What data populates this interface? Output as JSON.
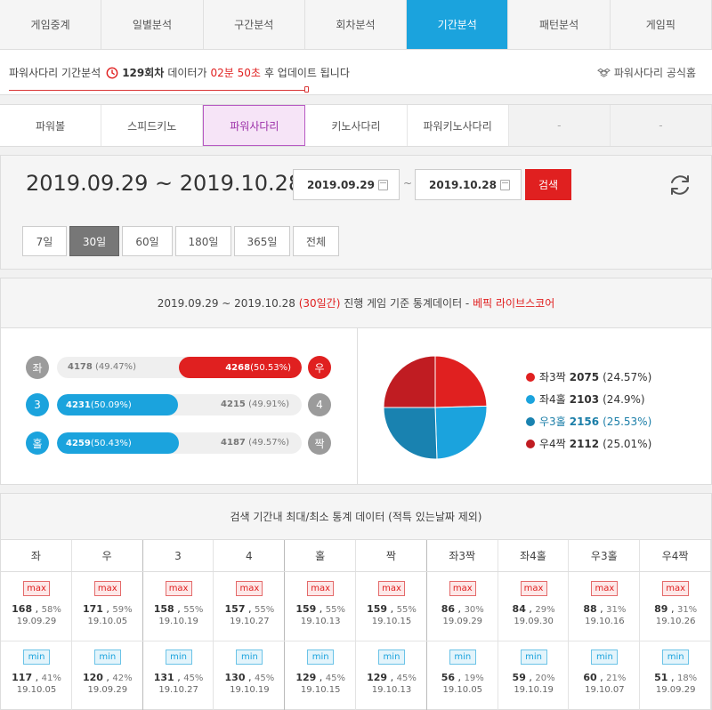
{
  "top_nav": [
    "게임중계",
    "일별분석",
    "구간분석",
    "회차분석",
    "기간분석",
    "패턴분석",
    "게임픽"
  ],
  "top_nav_active": 4,
  "info_bar": {
    "prefix": "파워사다리 기간분석",
    "round": "129회차",
    "mid": "데이터가",
    "timer": "02분 50초",
    "suffix": "후 업데이트 됩니다",
    "official": "파워사다리 공식홈"
  },
  "sub_nav": [
    "파워볼",
    "스피드키노",
    "파워사다리",
    "키노사다리",
    "파워키노사다리",
    "-",
    "-"
  ],
  "sub_nav_active": 2,
  "period": {
    "range": "2019.09.29 ~ 2019.10.28",
    "start": "2019.09.29",
    "tilde": "~",
    "end": "2019.10.28",
    "search_label": "검색",
    "buttons": [
      "7일",
      "30일",
      "60일",
      "180일",
      "365일",
      "전체"
    ],
    "active_button": 1
  },
  "stats": {
    "head_range": "2019.09.29 ~ 2019.10.28",
    "head_days": "(30일간)",
    "head_mid": "진행 게임 기준 통계데이터 -",
    "head_brand": "베픽 라이브스코어",
    "rows": [
      {
        "left_label": "좌",
        "left_count": "4178",
        "left_pct": "(49.47%)",
        "right_label": "우",
        "right_count": "4268",
        "right_pct": "(50.53%)",
        "winner": "right",
        "left_share": 0.4947,
        "color": "#e02020"
      },
      {
        "left_label": "3",
        "left_count": "4231",
        "left_pct": "(50.09%)",
        "right_label": "4",
        "right_count": "4215",
        "right_pct": "(49.91%)",
        "winner": "left",
        "left_share": 0.5009,
        "color": "#1ba3dd"
      },
      {
        "left_label": "홀",
        "left_count": "4259",
        "left_pct": "(50.43%)",
        "right_label": "짝",
        "right_count": "4187",
        "right_pct": "(49.57%)",
        "winner": "left",
        "left_share": 0.5043,
        "color": "#1ba3dd"
      }
    ]
  },
  "chart_data": {
    "type": "pie",
    "categories": [
      "좌3짝",
      "좌4홀",
      "우3홀",
      "우4짝"
    ],
    "values": [
      2075,
      2103,
      2156,
      2112
    ],
    "labels": [
      "2075",
      "2103",
      "2156",
      "2112"
    ],
    "percents": [
      "(24.57%)",
      "(24.9%)",
      "(25.53%)",
      "(25.01%)"
    ],
    "colors": [
      "#e02020",
      "#1ba3dd",
      "#1982b0",
      "#c01c22"
    ],
    "highlight": 2
  },
  "minmax": {
    "title": "검색 기간내 최대/최소 통계 데이터 (적특 있는날짜 제외)",
    "max_tag": "max",
    "min_tag": "min",
    "columns": [
      {
        "name": "좌",
        "max": "168",
        "max_pct": "58%",
        "max_date": "19.09.29",
        "min": "117",
        "min_pct": "41%",
        "min_date": "19.10.05"
      },
      {
        "name": "우",
        "max": "171",
        "max_pct": "59%",
        "max_date": "19.10.05",
        "min": "120",
        "min_pct": "42%",
        "min_date": "19.09.29"
      },
      {
        "name": "3",
        "max": "158",
        "max_pct": "55%",
        "max_date": "19.10.19",
        "min": "131",
        "min_pct": "45%",
        "min_date": "19.10.27"
      },
      {
        "name": "4",
        "max": "157",
        "max_pct": "55%",
        "max_date": "19.10.27",
        "min": "130",
        "min_pct": "45%",
        "min_date": "19.10.19"
      },
      {
        "name": "홀",
        "max": "159",
        "max_pct": "55%",
        "max_date": "19.10.13",
        "min": "129",
        "min_pct": "45%",
        "min_date": "19.10.15"
      },
      {
        "name": "짝",
        "max": "159",
        "max_pct": "55%",
        "max_date": "19.10.15",
        "min": "129",
        "min_pct": "45%",
        "min_date": "19.10.13"
      },
      {
        "name": "좌3짝",
        "max": "86",
        "max_pct": "30%",
        "max_date": "19.09.29",
        "min": "56",
        "min_pct": "19%",
        "min_date": "19.10.05"
      },
      {
        "name": "좌4홀",
        "max": "84",
        "max_pct": "29%",
        "max_date": "19.09.30",
        "min": "59",
        "min_pct": "20%",
        "min_date": "19.10.19"
      },
      {
        "name": "우3홀",
        "max": "88",
        "max_pct": "31%",
        "max_date": "19.10.16",
        "min": "60",
        "min_pct": "21%",
        "min_date": "19.10.07"
      },
      {
        "name": "우4짝",
        "max": "89",
        "max_pct": "31%",
        "max_date": "19.10.26",
        "min": "51",
        "min_pct": "18%",
        "min_date": "19.09.29"
      }
    ]
  }
}
